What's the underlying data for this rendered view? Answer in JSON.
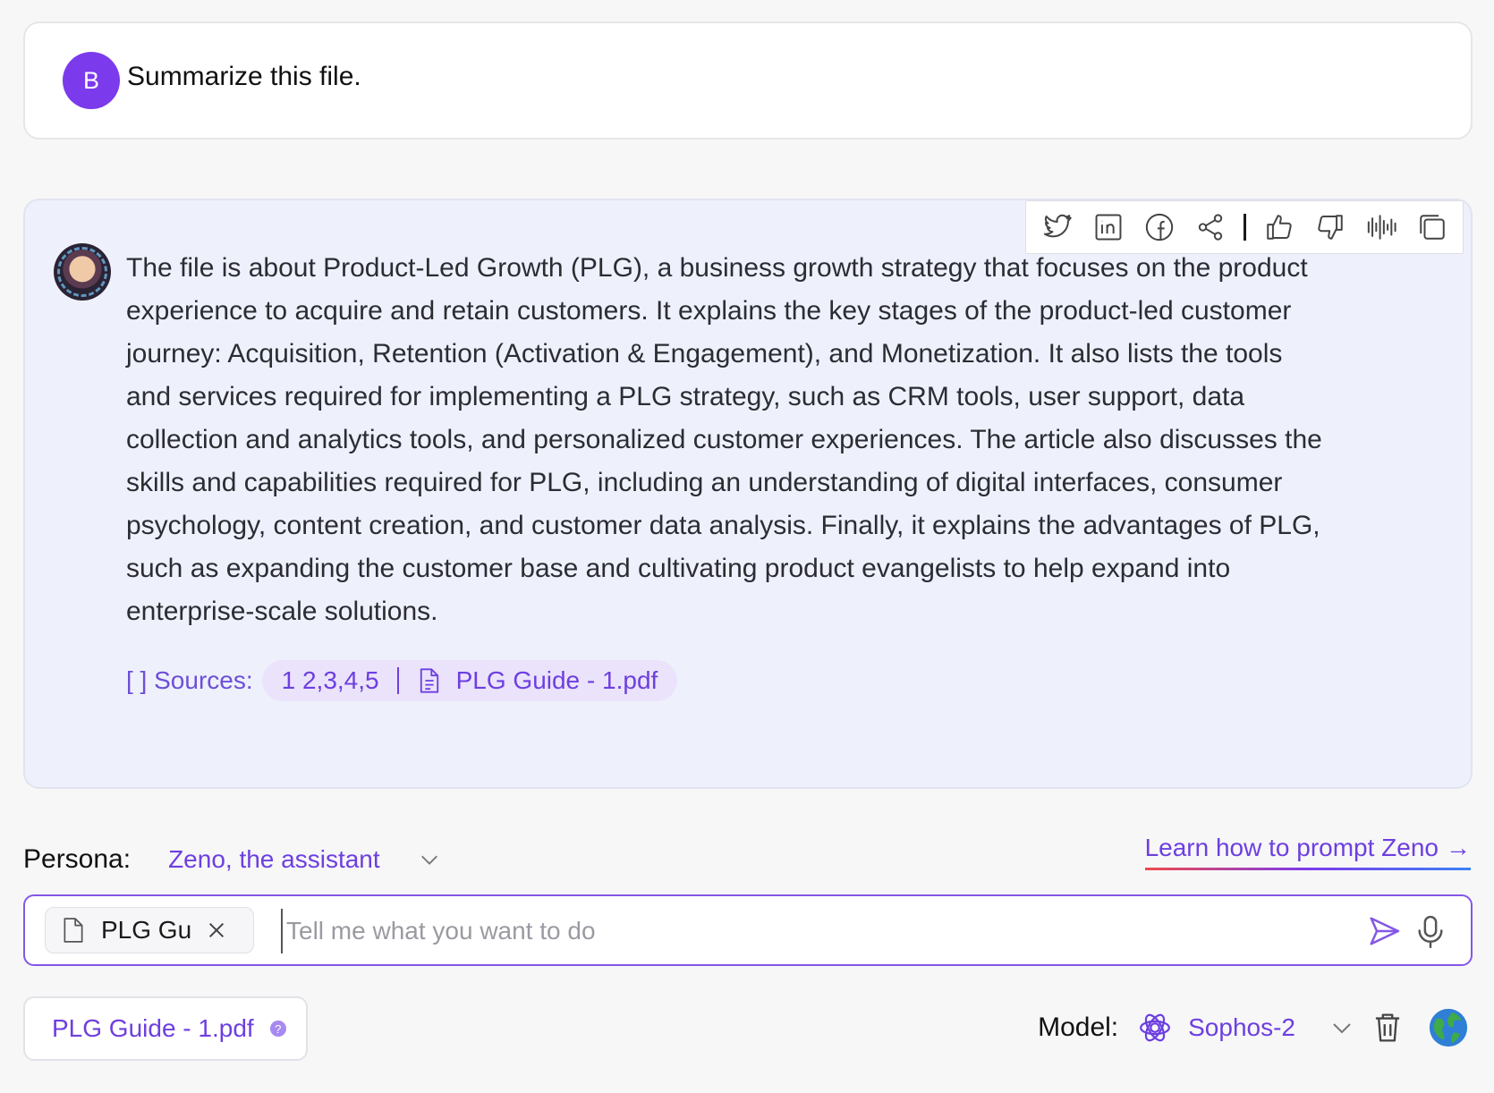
{
  "user_message": {
    "avatar_initial": "B",
    "text": "Summarize this file."
  },
  "assistant_message": {
    "text": "The file is about Product-Led Growth (PLG), a business growth strategy that focuses on the product experience to acquire and retain customers. It explains the key stages of the product-led customer journey: Acquisition, Retention (Activation & Engagement), and Monetization. It also lists the tools and services required for implementing a PLG strategy, such as CRM tools, user support, data collection and analytics tools, and personalized customer experiences. The article also discusses the skills and capabilities required for PLG, including an understanding of digital interfaces, consumer psychology, content creation, and customer data analysis. Finally, it explains the advantages of PLG, such as expanding the customer base and cultivating product evangelists to help expand into enterprise-scale solutions.",
    "sources_label": "[ ] Sources:",
    "sources_pages": "1 2,3,4,5",
    "sources_file": "PLG Guide - 1.pdf",
    "toolbar_icons": [
      "twitter-icon",
      "linkedin-icon",
      "facebook-icon",
      "share-icon",
      "thumbs-up-icon",
      "thumbs-down-icon",
      "audio-wave-icon",
      "copy-icon"
    ]
  },
  "persona": {
    "label": "Persona:",
    "value": "Zeno, the assistant",
    "learn_link": "Learn how to prompt Zeno",
    "learn_arrow": "→"
  },
  "input": {
    "attached_file": "PLG Gui",
    "placeholder": "Tell me what you want to do"
  },
  "footer": {
    "file_chip": "PLG Guide - 1.pdf",
    "help_glyph": "?",
    "model_label": "Model:",
    "model_value": "Sophos-2"
  },
  "colors": {
    "accent": "#6d3fe0",
    "user_avatar": "#7c3aed",
    "answer_bg": "#eef1fc",
    "input_border": "#8457e6"
  }
}
